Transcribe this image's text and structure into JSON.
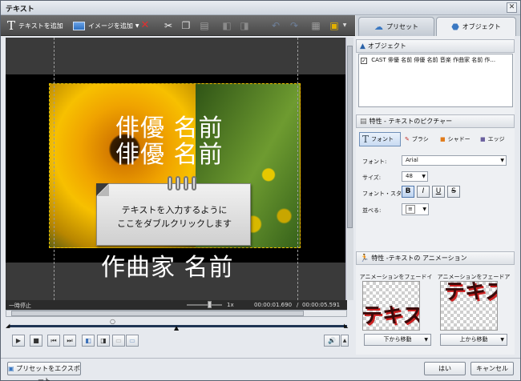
{
  "window": {
    "title": "テキスト",
    "close_glyph": "✕"
  },
  "toolbar": {
    "add_text_label": "テキストを追加",
    "add_image_label": "イメージを追加",
    "icons": [
      "delete-icon",
      "cut-icon",
      "copy-icon",
      "paste-icon",
      "bring-forward-icon",
      "send-backward-icon",
      "undo-icon",
      "redo-icon",
      "grid-icon",
      "background-icon"
    ]
  },
  "tabs": {
    "preset_label": "プリセット",
    "object_label": "オブジェクト"
  },
  "preview": {
    "line1": "俳優 名前",
    "line2": "俳優 名前",
    "line3": "作曲家 名前",
    "note_line1": "テキストを入力するように",
    "note_line2": "ここをダブルクリックします"
  },
  "status": {
    "state": "一時停止",
    "speed": "1x",
    "current_time": "00:00:01.690",
    "separator": "/",
    "total_time": "00:00:05.591"
  },
  "objects": {
    "header": "オブジェクト",
    "items": [
      {
        "checked": true,
        "label": "CAST 俳優 名前 俳優 名前 音楽 作曲家 名前 作..."
      }
    ]
  },
  "properties": {
    "header": "特性 - テキストのピクチャー",
    "tabs": [
      "フォント",
      "ブラシ",
      "シャドー",
      "エッジ"
    ],
    "font_label": "フォント:",
    "font_value": "Arial",
    "size_label": "サイズ:",
    "size_value": "48",
    "style_label": "フォント・スタイル:",
    "style_buttons": [
      "B",
      "I",
      "U",
      "S"
    ],
    "align_label": "並べる:",
    "align_value": "≡"
  },
  "animation": {
    "header": "特性 -テキストの アニメーション",
    "fade_in_label": "アニメーションをフェードイン",
    "fade_out_label": "アニメーションをフェードアウト",
    "preview_text": "テキスト",
    "fade_in_value": "下から移動",
    "fade_out_value": "上から移動"
  },
  "footer": {
    "export_label": "プリセットをエクスポート",
    "ok_label": "はい",
    "cancel_label": "キャンセル"
  },
  "playback": {
    "position_fraction": 0.5
  }
}
